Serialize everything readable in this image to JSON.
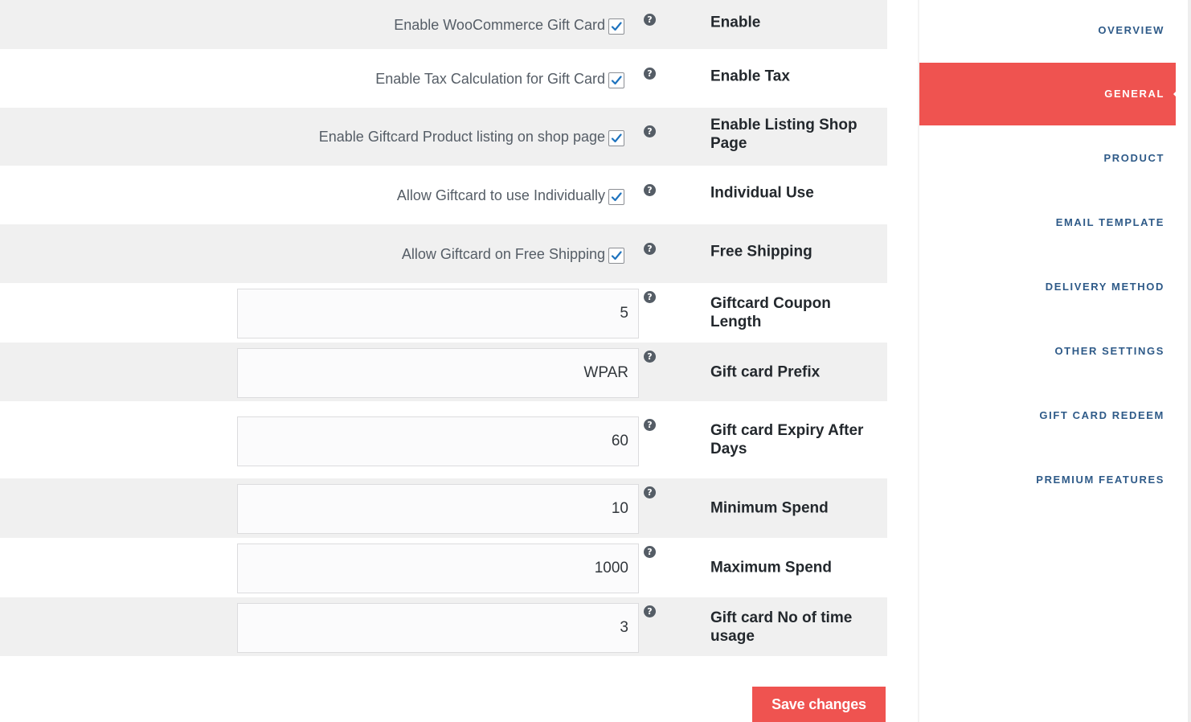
{
  "checkbox_rows": [
    {
      "description": "Enable WooCommerce Gift Card",
      "checked": true,
      "label": "Enable"
    },
    {
      "description": "Enable Tax Calculation for Gift Card",
      "checked": true,
      "label": "Enable Tax"
    },
    {
      "description": "Enable Giftcard Product listing on shop page",
      "checked": true,
      "label": "Enable Listing Shop Page"
    },
    {
      "description": "Allow Giftcard to use Individually",
      "checked": true,
      "label": "Individual Use"
    },
    {
      "description": "Allow Giftcard on Free Shipping",
      "checked": true,
      "label": "Free Shipping"
    }
  ],
  "input_rows": [
    {
      "value": "5",
      "label": "Giftcard Coupon Length"
    },
    {
      "value": "WPAR",
      "label": "Gift card Prefix"
    },
    {
      "value": "60",
      "label": "Gift card Expiry After Days"
    },
    {
      "value": "10",
      "label": "Minimum Spend"
    },
    {
      "value": "1000",
      "label": "Maximum Spend"
    },
    {
      "value": "3",
      "label": "Gift card No of time usage"
    }
  ],
  "help_glyph": "?",
  "help_icon": "help-circle-icon",
  "save_label": "Save changes",
  "nav": {
    "items": [
      {
        "label": "OVERVIEW",
        "active": false
      },
      {
        "label": "GENERAL",
        "active": true
      },
      {
        "label": "PRODUCT",
        "active": false
      },
      {
        "label": "EMAIL TEMPLATE",
        "active": false
      },
      {
        "label": "DELIVERY METHOD",
        "active": false
      },
      {
        "label": "OTHER SETTINGS",
        "active": false
      },
      {
        "label": "GIFT CARD REDEEM",
        "active": false
      },
      {
        "label": "PREMIUM FEATURES",
        "active": false
      }
    ]
  },
  "colors": {
    "accent": "#ef5350",
    "nav_text": "#2e5a88",
    "row_shade": "#f0f0f0",
    "checkmark": "#1e73be"
  }
}
